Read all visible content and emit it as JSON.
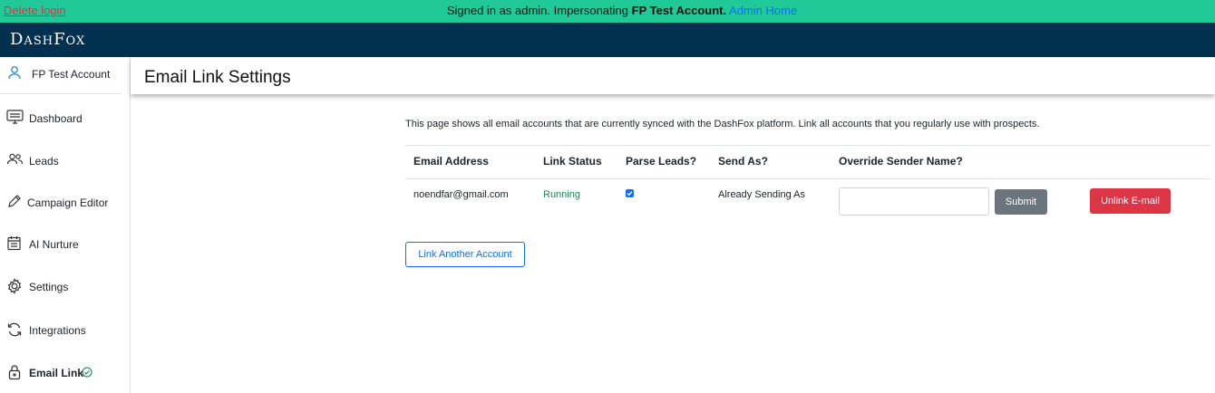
{
  "banner": {
    "delete_label": "Delete login",
    "prefix": "Signed in as admin. Impersonating ",
    "account": "FP Test Account.",
    "admin_home": "Admin Home"
  },
  "navbar": {
    "brand": "DashFox"
  },
  "sidebar": {
    "account_label": "FP Test Account",
    "items": [
      {
        "label": "Dashboard",
        "icon": "monitor-icon"
      },
      {
        "label": "Leads",
        "icon": "users-icon"
      },
      {
        "label": "Campaign Editor",
        "icon": "pencil-icon"
      },
      {
        "label": "AI Nurture",
        "icon": "calendar-icon"
      },
      {
        "label": "Settings",
        "icon": "gear-icon"
      },
      {
        "label": "Integrations",
        "icon": "refresh-icon"
      },
      {
        "label": "Email Link",
        "icon": "lock-icon"
      }
    ]
  },
  "page": {
    "title": "Email Link Settings",
    "description": "This page shows all email accounts that are currently synced with the DashFox platform. Link all accounts that you regularly use with prospects."
  },
  "table": {
    "headers": [
      "Email Address",
      "Link Status",
      "Parse Leads?",
      "Send As?",
      "Override Sender Name?"
    ],
    "rows": [
      {
        "email": "noendfar@gmail.com",
        "status": "Running",
        "parse_leads": true,
        "send_as": "Already Sending As",
        "override_value": "",
        "submit_label": "Submit",
        "unlink_label": "Unlink E-mail"
      }
    ]
  },
  "link_another_label": "Link Another Account",
  "colors": {
    "banner": "#20c997",
    "navbar": "#02304f",
    "running": "#198754",
    "primary": "#0d6efd",
    "danger": "#dc3545",
    "secondary": "#6c757d"
  }
}
